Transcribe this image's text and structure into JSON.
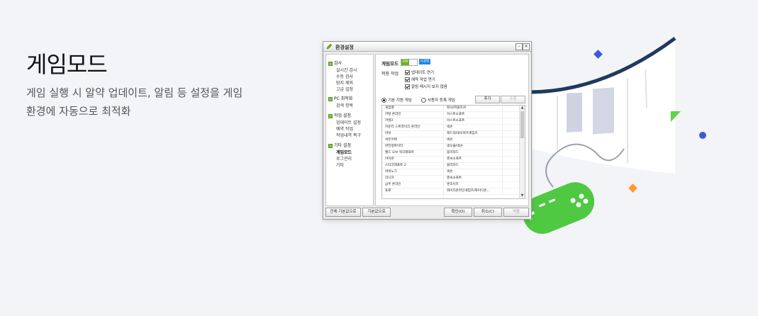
{
  "hero": {
    "title": "게임모드",
    "description": "게임 실행 시 알약 업데이트, 알림 등 설정을 게임 환경에 자동으로 최적화"
  },
  "window": {
    "title": "환경설정",
    "min_label": "–",
    "close_label": "✕"
  },
  "tree": {
    "groups": [
      {
        "label": "검사",
        "items": [
          "실시간 감시",
          "수동 검사",
          "탐지 제외",
          "고급 설정"
        ]
      },
      {
        "label": "PC 최적화",
        "items": [
          "검색 항목"
        ]
      },
      {
        "label": "작업 설정",
        "items": [
          "업데이트 설정",
          "예약 작업",
          "작업내역 복구"
        ]
      },
      {
        "label": "기타 설정",
        "items": [
          "게임모드",
          "로그관리",
          "기타"
        ]
      }
    ]
  },
  "panel": {
    "gamemode_label": "게임모드",
    "toggle_on": "ON",
    "help": "도움말",
    "apply_label": "적용 작업",
    "checks": [
      "업데이트 연기",
      "예약 작업 연기",
      "알림 메시지 보지 않음"
    ],
    "radio_default": "기본 지원 게임",
    "radio_user": "사용자 등록 게임",
    "add": "추가",
    "edit": "수정"
  },
  "list": {
    "header": [
      "게임명",
      "회사/퍼블리셔"
    ],
    "rows": [
      [
        "카발 온라인",
        "이스트소프트"
      ],
      [
        "카발2",
        "이스트소프트"
      ],
      [
        "카운터 스트라이크 온라인",
        "넥슨"
      ],
      [
        "마비",
        "레드덕/네오위즈게임즈"
      ],
      [
        "서든어택",
        "넥슨"
      ],
      [
        "완전정파이터",
        "네오플/넥슨"
      ],
      [
        "월드 오브 워크래프트",
        "블리자드"
      ],
      [
        "아이온",
        "엔씨소프트"
      ],
      [
        "스타크래프트 2",
        "블리자드"
      ],
      [
        "마비노기",
        "넥슨"
      ],
      [
        "리니지",
        "엔씨소프트"
      ],
      [
        "금주 온라인",
        "엔조이즈"
      ],
      [
        "포판",
        "와이디온라인게임즈/와이디온..."
      ]
    ]
  },
  "footer": {
    "reset_all": "전체 기본값으로",
    "reset": "기본값으로",
    "ok": "확인(O)",
    "cancel": "취소(C)",
    "apply": "적용"
  },
  "colors": {
    "accent_green": "#6fb51a",
    "gamepad_green": "#4fc842",
    "navy": "#1f3a5c",
    "blue_dot": "#3b5bd6",
    "orange": "#ff9a2e"
  }
}
